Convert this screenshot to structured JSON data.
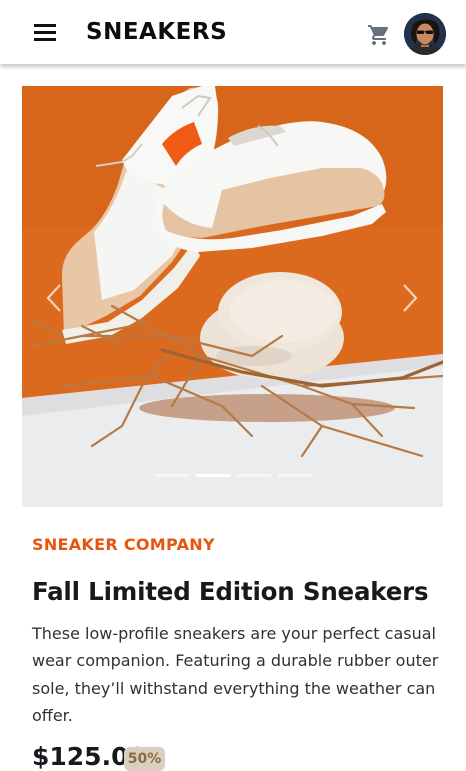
{
  "header": {
    "brand": "SNEAKERS",
    "menu_icon": "menu-icon",
    "cart_icon": "cart-icon",
    "avatar": "user-avatar"
  },
  "gallery": {
    "prev_icon": "chevron-left-icon",
    "next_icon": "chevron-right-icon",
    "slides": 4,
    "active_slide": 2,
    "image": "white-and-beige-sneakers-on-stones"
  },
  "product": {
    "company": "SNEAKER COMPANY",
    "title": "Fall Limited Edition Sneakers",
    "description": "These low-profile sneakers are your perfect casual wear companion. Featuring a durable rubber outer sole, they’ll withstand everything the weather can offer.",
    "price": "$125.00",
    "discount": "50%"
  },
  "colors": {
    "accent": "#e4560e",
    "text_dark": "#17191f",
    "discount_bg": "#d8cfbe"
  }
}
